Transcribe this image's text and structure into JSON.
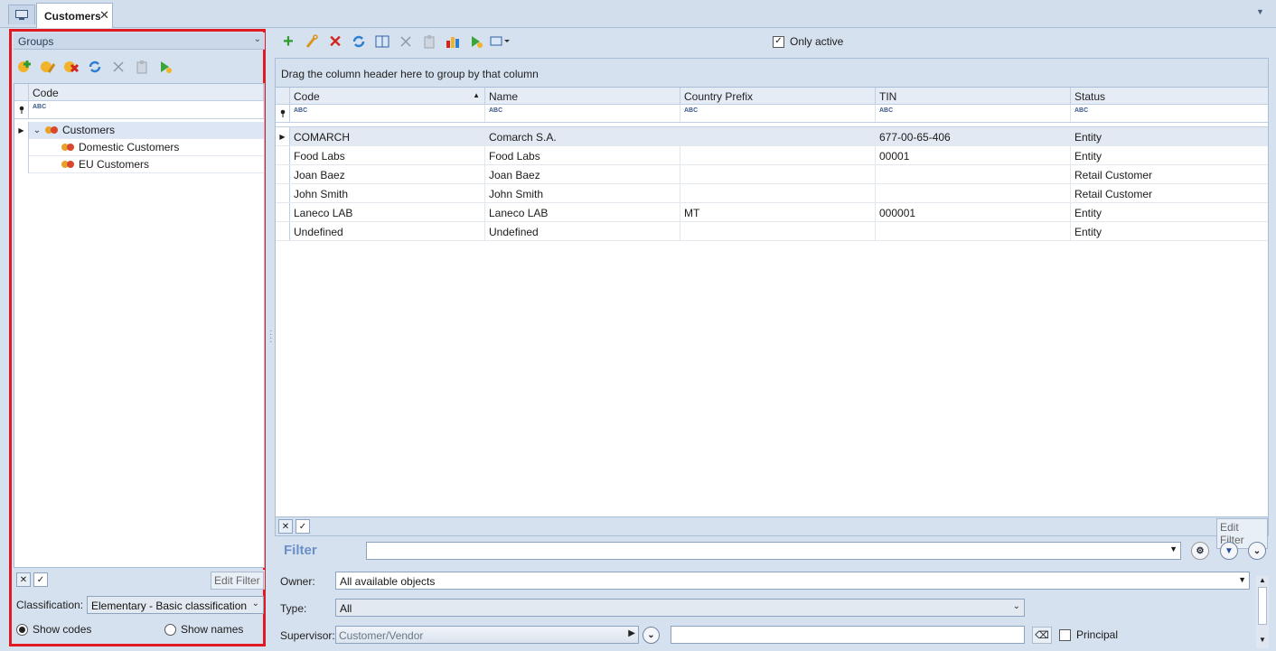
{
  "tabs": {
    "active": "Customers",
    "close": "✕",
    "menu": "▼"
  },
  "groups": {
    "title": "Groups",
    "chevron": "⌄",
    "column": "Code",
    "filter_hint": "ABC",
    "tree": [
      {
        "label": "Customers",
        "expander": "⌄",
        "selected": true
      },
      {
        "label": "Domestic Customers"
      },
      {
        "label": "EU Customers"
      }
    ],
    "edit_filter": "Edit Filter",
    "classification_label": "Classification:",
    "classification_value": "Elementary - Basic classification",
    "show_codes": "Show codes",
    "show_names": "Show names"
  },
  "toolbar": {
    "only_active": "Only active"
  },
  "grid": {
    "drag_hint": "Drag the column header here to group by that column",
    "columns": [
      "Code",
      "Name",
      "Country Prefix",
      "TIN",
      "Status"
    ],
    "filter_hint": "ABC",
    "rows": [
      {
        "code": "COMARCH",
        "name": "Comarch S.A.",
        "prefix": "",
        "tin": "677-00-65-406",
        "status": "Entity"
      },
      {
        "code": "Food Labs",
        "name": "Food Labs",
        "prefix": "",
        "tin": "00001",
        "status": "Entity"
      },
      {
        "code": "Joan Baez",
        "name": "Joan Baez",
        "prefix": "",
        "tin": "",
        "status": "Retail Customer"
      },
      {
        "code": "John Smith",
        "name": "John Smith",
        "prefix": "",
        "tin": "",
        "status": "Retail Customer"
      },
      {
        "code": "Laneco LAB",
        "name": "Laneco LAB",
        "prefix": "MT",
        "tin": "000001",
        "status": "Entity"
      },
      {
        "code": "Undefined",
        "name": "Undefined",
        "prefix": "",
        "tin": "",
        "status": "Entity"
      }
    ],
    "edit_filter": "Edit Filter"
  },
  "filter": {
    "title": "Filter",
    "owner_label": "Owner:",
    "owner_value": "All available objects",
    "type_label": "Type:",
    "type_value": "All",
    "supervisor_label": "Supervisor:",
    "supervisor_value": "Customer/Vendor",
    "principal_label": "Principal"
  },
  "colors": {
    "highlight_border": "#e01a22",
    "filter_title": "#6a8fc7"
  }
}
